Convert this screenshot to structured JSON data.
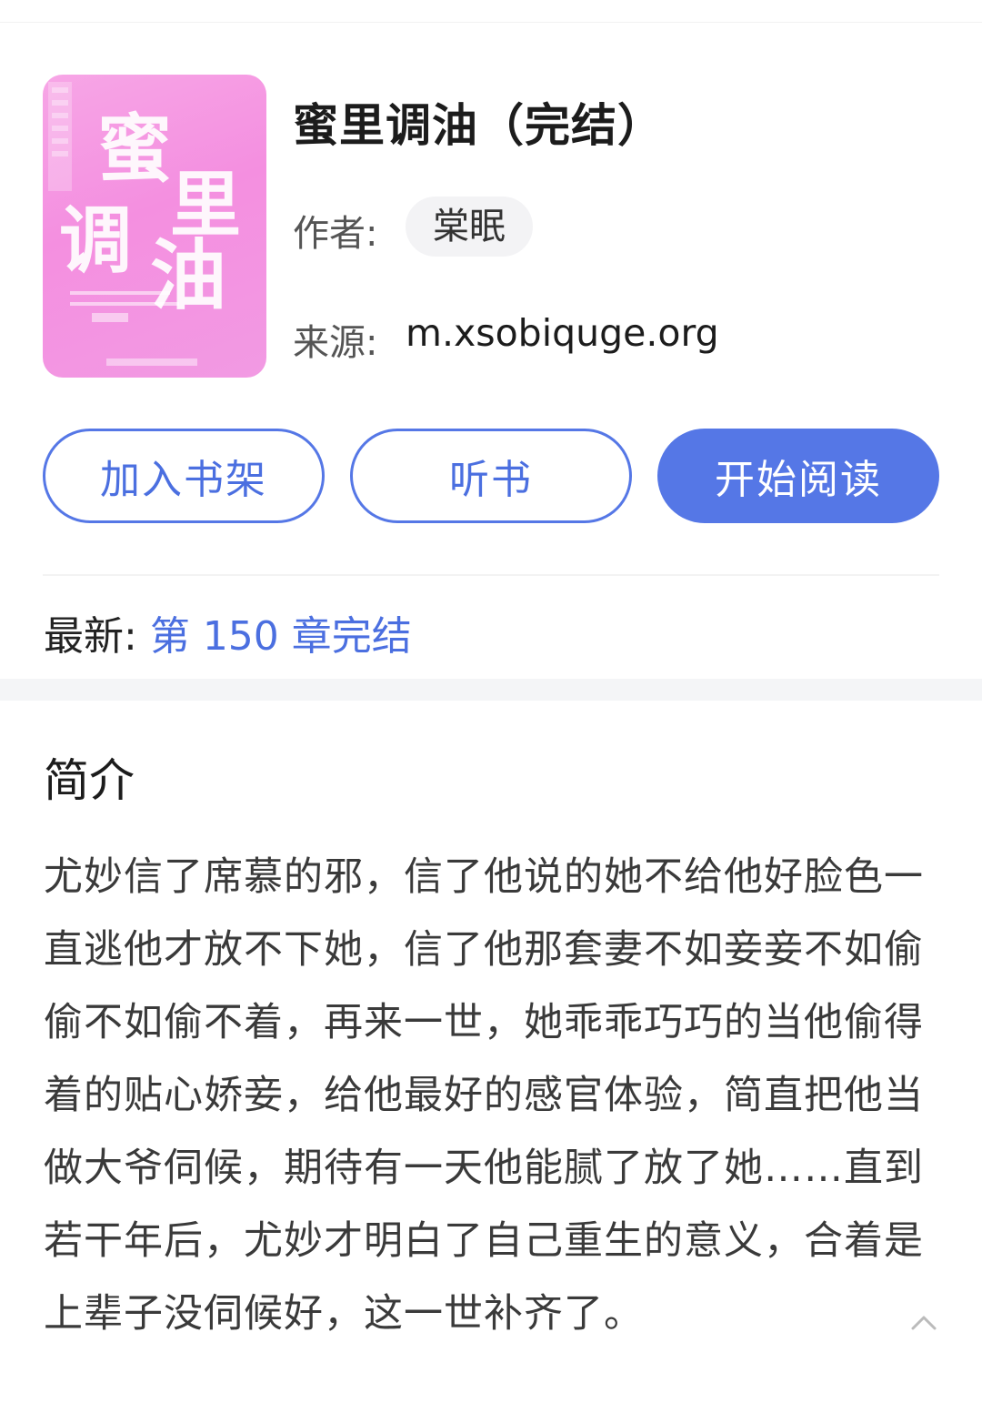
{
  "book": {
    "title": "蜜里调油（完结）",
    "author_label": "作者:",
    "author": "棠眠",
    "source_label": "来源:",
    "source": "m.xsobiquge.org",
    "cover_text": "蜜里调油"
  },
  "actions": {
    "add_shelf": "加入书架",
    "listen": "听书",
    "start_reading": "开始阅读"
  },
  "latest": {
    "label": "最新:",
    "chapter": "第 150 章完结"
  },
  "intro": {
    "heading": "简介",
    "text": "尤妙信了席慕的邪，信了他说的她不给他好脸色一直逃他才放不下她，信了他那套妻不如妾妾不如偷偷不如偷不着，再来一世，她乖乖巧巧的当他偷得着的贴心娇妾，给他最好的感官体验，简直把他当做大爷伺候，期待有一天他能腻了放了她……直到若干年后，尤妙才明白了自己重生的意义，合着是上辈子没伺候好，这一世补齐了。"
  },
  "icons": {
    "collapse": "chevron-up-icon"
  },
  "colors": {
    "accent": "#5577e6",
    "link": "#4b6fe0",
    "cover_bg": "#f48fe0"
  }
}
